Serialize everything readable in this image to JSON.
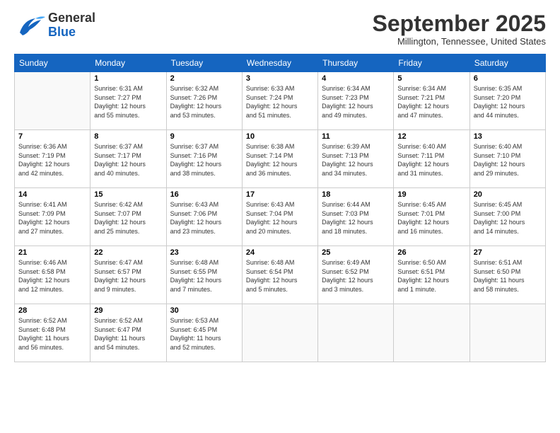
{
  "logo": {
    "line1": "General",
    "line2": "Blue"
  },
  "title": "September 2025",
  "location": "Millington, Tennessee, United States",
  "weekdays": [
    "Sunday",
    "Monday",
    "Tuesday",
    "Wednesday",
    "Thursday",
    "Friday",
    "Saturday"
  ],
  "weeks": [
    [
      {
        "day": "",
        "info": ""
      },
      {
        "day": "1",
        "info": "Sunrise: 6:31 AM\nSunset: 7:27 PM\nDaylight: 12 hours\nand 55 minutes."
      },
      {
        "day": "2",
        "info": "Sunrise: 6:32 AM\nSunset: 7:26 PM\nDaylight: 12 hours\nand 53 minutes."
      },
      {
        "day": "3",
        "info": "Sunrise: 6:33 AM\nSunset: 7:24 PM\nDaylight: 12 hours\nand 51 minutes."
      },
      {
        "day": "4",
        "info": "Sunrise: 6:34 AM\nSunset: 7:23 PM\nDaylight: 12 hours\nand 49 minutes."
      },
      {
        "day": "5",
        "info": "Sunrise: 6:34 AM\nSunset: 7:21 PM\nDaylight: 12 hours\nand 47 minutes."
      },
      {
        "day": "6",
        "info": "Sunrise: 6:35 AM\nSunset: 7:20 PM\nDaylight: 12 hours\nand 44 minutes."
      }
    ],
    [
      {
        "day": "7",
        "info": "Sunrise: 6:36 AM\nSunset: 7:19 PM\nDaylight: 12 hours\nand 42 minutes."
      },
      {
        "day": "8",
        "info": "Sunrise: 6:37 AM\nSunset: 7:17 PM\nDaylight: 12 hours\nand 40 minutes."
      },
      {
        "day": "9",
        "info": "Sunrise: 6:37 AM\nSunset: 7:16 PM\nDaylight: 12 hours\nand 38 minutes."
      },
      {
        "day": "10",
        "info": "Sunrise: 6:38 AM\nSunset: 7:14 PM\nDaylight: 12 hours\nand 36 minutes."
      },
      {
        "day": "11",
        "info": "Sunrise: 6:39 AM\nSunset: 7:13 PM\nDaylight: 12 hours\nand 34 minutes."
      },
      {
        "day": "12",
        "info": "Sunrise: 6:40 AM\nSunset: 7:11 PM\nDaylight: 12 hours\nand 31 minutes."
      },
      {
        "day": "13",
        "info": "Sunrise: 6:40 AM\nSunset: 7:10 PM\nDaylight: 12 hours\nand 29 minutes."
      }
    ],
    [
      {
        "day": "14",
        "info": "Sunrise: 6:41 AM\nSunset: 7:09 PM\nDaylight: 12 hours\nand 27 minutes."
      },
      {
        "day": "15",
        "info": "Sunrise: 6:42 AM\nSunset: 7:07 PM\nDaylight: 12 hours\nand 25 minutes."
      },
      {
        "day": "16",
        "info": "Sunrise: 6:43 AM\nSunset: 7:06 PM\nDaylight: 12 hours\nand 23 minutes."
      },
      {
        "day": "17",
        "info": "Sunrise: 6:43 AM\nSunset: 7:04 PM\nDaylight: 12 hours\nand 20 minutes."
      },
      {
        "day": "18",
        "info": "Sunrise: 6:44 AM\nSunset: 7:03 PM\nDaylight: 12 hours\nand 18 minutes."
      },
      {
        "day": "19",
        "info": "Sunrise: 6:45 AM\nSunset: 7:01 PM\nDaylight: 12 hours\nand 16 minutes."
      },
      {
        "day": "20",
        "info": "Sunrise: 6:45 AM\nSunset: 7:00 PM\nDaylight: 12 hours\nand 14 minutes."
      }
    ],
    [
      {
        "day": "21",
        "info": "Sunrise: 6:46 AM\nSunset: 6:58 PM\nDaylight: 12 hours\nand 12 minutes."
      },
      {
        "day": "22",
        "info": "Sunrise: 6:47 AM\nSunset: 6:57 PM\nDaylight: 12 hours\nand 9 minutes."
      },
      {
        "day": "23",
        "info": "Sunrise: 6:48 AM\nSunset: 6:55 PM\nDaylight: 12 hours\nand 7 minutes."
      },
      {
        "day": "24",
        "info": "Sunrise: 6:48 AM\nSunset: 6:54 PM\nDaylight: 12 hours\nand 5 minutes."
      },
      {
        "day": "25",
        "info": "Sunrise: 6:49 AM\nSunset: 6:52 PM\nDaylight: 12 hours\nand 3 minutes."
      },
      {
        "day": "26",
        "info": "Sunrise: 6:50 AM\nSunset: 6:51 PM\nDaylight: 12 hours\nand 1 minute."
      },
      {
        "day": "27",
        "info": "Sunrise: 6:51 AM\nSunset: 6:50 PM\nDaylight: 11 hours\nand 58 minutes."
      }
    ],
    [
      {
        "day": "28",
        "info": "Sunrise: 6:52 AM\nSunset: 6:48 PM\nDaylight: 11 hours\nand 56 minutes."
      },
      {
        "day": "29",
        "info": "Sunrise: 6:52 AM\nSunset: 6:47 PM\nDaylight: 11 hours\nand 54 minutes."
      },
      {
        "day": "30",
        "info": "Sunrise: 6:53 AM\nSunset: 6:45 PM\nDaylight: 11 hours\nand 52 minutes."
      },
      {
        "day": "",
        "info": ""
      },
      {
        "day": "",
        "info": ""
      },
      {
        "day": "",
        "info": ""
      },
      {
        "day": "",
        "info": ""
      }
    ]
  ]
}
